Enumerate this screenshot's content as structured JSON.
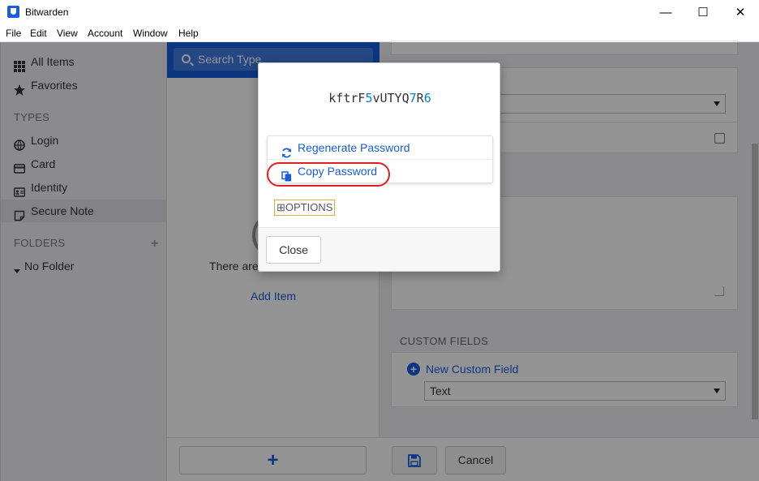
{
  "window": {
    "title": "Bitwarden",
    "controls": {
      "minimize": "—",
      "maximize": "☐",
      "close": "✕"
    }
  },
  "menu": [
    "File",
    "Edit",
    "View",
    "Account",
    "Window",
    "Help"
  ],
  "sidebar": {
    "items": [
      {
        "label": "All Items",
        "icon": "grid-icon"
      },
      {
        "label": "Favorites",
        "icon": "star-icon"
      }
    ],
    "types_heading": "TYPES",
    "types": [
      {
        "label": "Login",
        "icon": "globe-icon"
      },
      {
        "label": "Card",
        "icon": "credit-card-icon"
      },
      {
        "label": "Identity",
        "icon": "id-card-icon"
      },
      {
        "label": "Secure Note",
        "icon": "sticky-note-icon",
        "active": true
      }
    ],
    "folders_heading": "FOLDERS",
    "add_folder_icon": "+",
    "folders": [
      {
        "label": "No Folder",
        "icon": "caret-down-icon"
      }
    ]
  },
  "list": {
    "search_placeholder": "Search Type",
    "empty_text": "There are no items to list.",
    "add_item_label": "Add Item",
    "add_button": "+"
  },
  "detail": {
    "custom_fields_heading": "CUSTOM FIELDS",
    "new_custom_field_label": "New Custom Field",
    "field_type_value": "Text",
    "cancel_label": "Cancel"
  },
  "modal": {
    "password_parts": [
      {
        "text": "kftrF",
        "num": false
      },
      {
        "text": "5",
        "num": true
      },
      {
        "text": "vUTYQ",
        "num": false
      },
      {
        "text": "7",
        "num": true
      },
      {
        "text": "R",
        "num": false
      },
      {
        "text": "6",
        "num": true
      }
    ],
    "regenerate_label": "Regenerate Password",
    "copy_label": "Copy Password",
    "options_label": "OPTIONS",
    "options_icon": "⊞",
    "close_label": "Close"
  },
  "colors": {
    "accent": "#175ddc",
    "annotation": "#e02020",
    "number": "#007fd2"
  }
}
